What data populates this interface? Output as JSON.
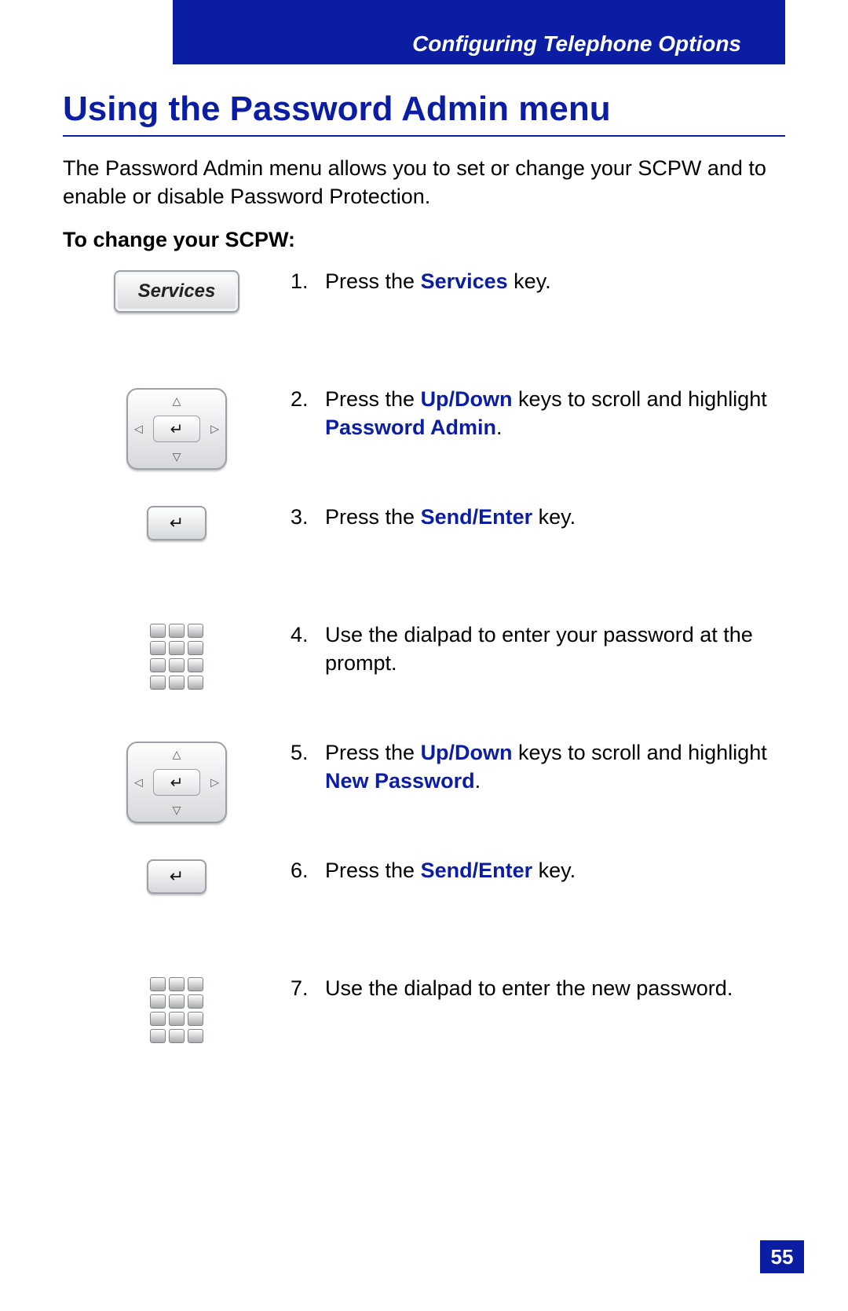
{
  "header": {
    "section": "Configuring Telephone Options"
  },
  "title": "Using the Password Admin menu",
  "intro": "The Password Admin menu allows you to set or change your SCPW and to enable or disable Password Protection.",
  "subhead": "To change your SCPW:",
  "services_label": "Services",
  "steps": [
    {
      "n": "1.",
      "icon": "services",
      "parts": [
        {
          "t": "Press the "
        },
        {
          "t": "Services",
          "b": true
        },
        {
          "t": " key."
        }
      ]
    },
    {
      "n": "2.",
      "icon": "navpad",
      "parts": [
        {
          "t": "Press the "
        },
        {
          "t": "Up/Down",
          "b": true
        },
        {
          "t": " keys to scroll and highlight "
        },
        {
          "t": "Password Admin",
          "b": true
        },
        {
          "t": "."
        }
      ]
    },
    {
      "n": "3.",
      "icon": "enter",
      "parts": [
        {
          "t": "Press the "
        },
        {
          "t": "Send/Enter",
          "b": true
        },
        {
          "t": " key."
        }
      ]
    },
    {
      "n": "4.",
      "icon": "dialpad",
      "parts": [
        {
          "t": "Use the dialpad to enter your password at the prompt."
        }
      ]
    },
    {
      "n": "5.",
      "icon": "navpad",
      "parts": [
        {
          "t": "Press the "
        },
        {
          "t": "Up/Down",
          "b": true
        },
        {
          "t": " keys to scroll and highlight "
        },
        {
          "t": "New Password",
          "b": true
        },
        {
          "t": "."
        }
      ]
    },
    {
      "n": "6.",
      "icon": "enter",
      "parts": [
        {
          "t": "Press the "
        },
        {
          "t": "Send/Enter",
          "b": true
        },
        {
          "t": " key."
        }
      ]
    },
    {
      "n": "7.",
      "icon": "dialpad",
      "parts": [
        {
          "t": "Use the dialpad to enter the new password."
        }
      ]
    }
  ],
  "page_number": "55"
}
